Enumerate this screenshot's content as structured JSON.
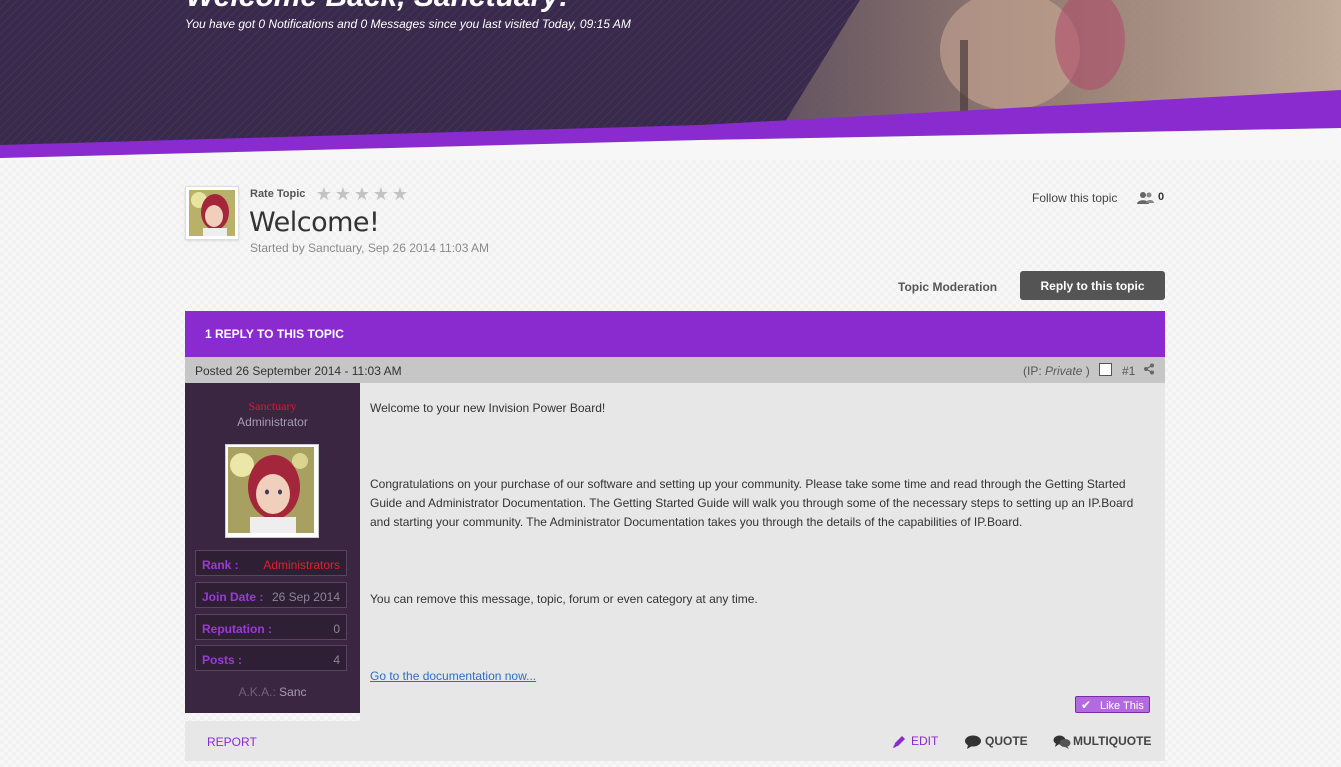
{
  "colors": {
    "header_bg": "#3a2a4e",
    "accent_purple": "#8a2bcf",
    "author_panel": "#3a2641",
    "reply_button": "#545454"
  },
  "header": {
    "welcome_title": "Welcome Back, Sanctuary!",
    "welcome_subtitle": "You have got 0 Notifications and 0 Messages since you last visited Today, 09:15 AM"
  },
  "topic": {
    "rate_label": "Rate Topic",
    "rating_stars": 0,
    "title": "Welcome!",
    "started_by": "Started by Sanctuary, Sep 26 2014 11:03 AM",
    "follow_label": "Follow this topic",
    "follow_count": "0",
    "moderation_label": "Topic Moderation",
    "reply_button_label": "Reply to this topic",
    "reply_count_header": "1 REPLY TO THIS TOPIC"
  },
  "post": {
    "posted_date": "Posted 26 September 2014 - 11:03 AM",
    "ip_prefix": "(IP:",
    "ip_value": "Private",
    "ip_suffix": ")",
    "post_number": "#1",
    "author": {
      "name": "Sanctuary",
      "group": "Administrator",
      "stats": [
        {
          "label": "Rank :",
          "value": "Administrators"
        },
        {
          "label": "Join Date :",
          "value": "26 Sep 2014"
        },
        {
          "label": "Reputation :",
          "value": "0"
        },
        {
          "label": "Posts :",
          "value": "4"
        }
      ],
      "aka_label": "A.K.A.:",
      "aka_value": "Sanc"
    },
    "body": {
      "p1": "Welcome to your new Invision Power Board!",
      "p2": "Congratulations on your purchase of our software and setting up your community. Please take some time and read through the Getting Started Guide and Administrator Documentation. The Getting Started Guide will walk you through some of the necessary steps to setting up an IP.Board and starting your community. The Administrator Documentation takes you through the details of the capabilities of IP.Board.",
      "p3": "You can remove this message, topic, forum or even category at any time.",
      "link": "Go to the documentation now..."
    },
    "like_label": "Like This",
    "footer": {
      "report": "REPORT",
      "edit": "EDIT",
      "quote": "QUOTE",
      "multiquote": "MULTIQUOTE"
    }
  }
}
